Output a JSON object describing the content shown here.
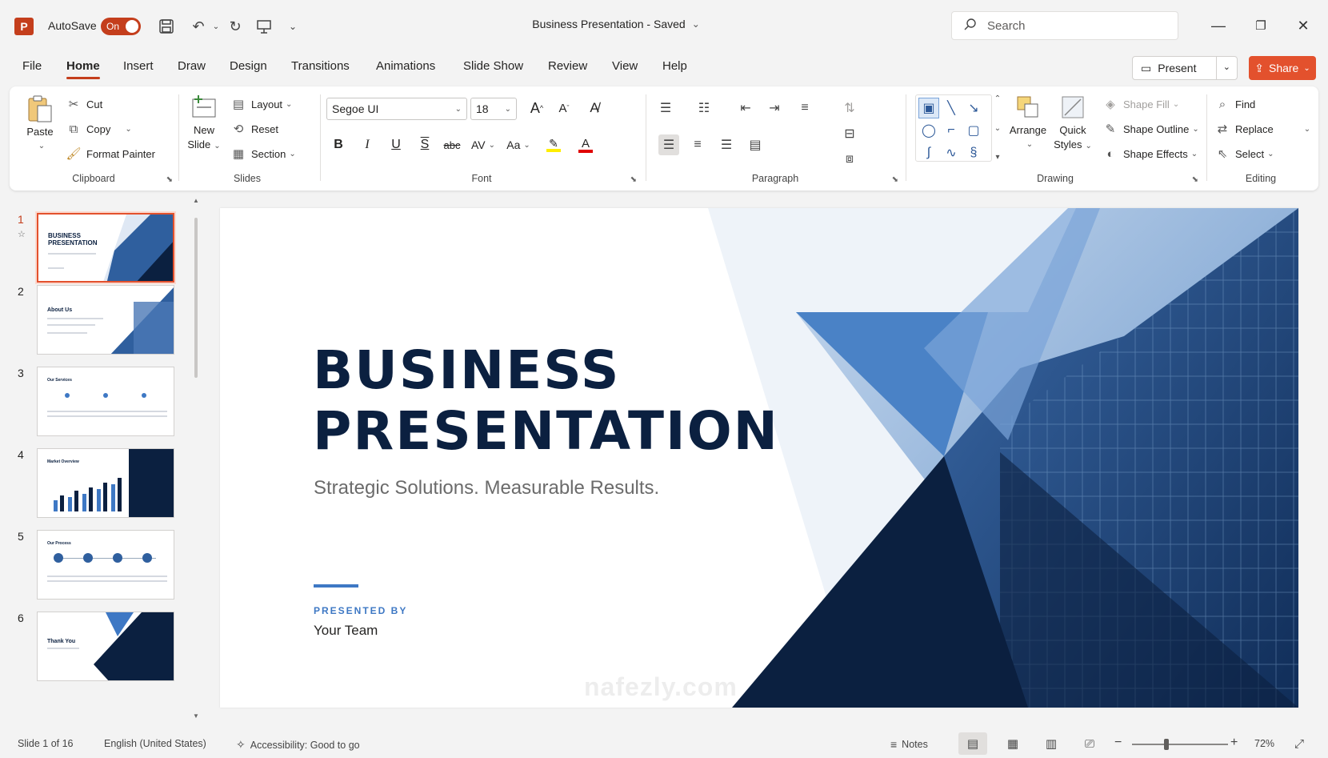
{
  "titlebar": {
    "app_icon": "powerpoint-logo",
    "autosave_label": "AutoSave",
    "autosave_state": "On",
    "doc_title": "Business Presentation  -  Saved",
    "search_placeholder": "Search"
  },
  "tabs": [
    {
      "label": "File"
    },
    {
      "label": "Home"
    },
    {
      "label": "Insert"
    },
    {
      "label": "Draw"
    },
    {
      "label": "Design"
    },
    {
      "label": "Transitions"
    },
    {
      "label": "Animations"
    },
    {
      "label": "Slide Show"
    },
    {
      "label": "Review"
    },
    {
      "label": "View"
    },
    {
      "label": "Help"
    }
  ],
  "active_tab": "Home",
  "present_label": "Present",
  "share_label": "Share",
  "ribbon": {
    "clipboard": {
      "paste": "Paste",
      "cut": "Cut",
      "copy": "Copy",
      "format_painter": "Format Painter",
      "label": "Clipboard"
    },
    "slides": {
      "new_slide_1": "New",
      "new_slide_2": "Slide",
      "layout": "Layout",
      "reset": "Reset",
      "section": "Section",
      "label": "Slides"
    },
    "font": {
      "family": "Segoe UI",
      "size": "18",
      "label": "Font",
      "bold": "B",
      "italic": "I",
      "underline": "U",
      "strike": "S",
      "abc": "abc",
      "spacing": "AV",
      "case": "Aa",
      "highlight": "A",
      "color": "A",
      "grow": "A",
      "shrink": "A"
    },
    "paragraph": {
      "label": "Paragraph"
    },
    "drawing": {
      "arrange": "Arrange",
      "quick_1": "Quick",
      "quick_2": "Styles",
      "shape_fill": "Shape Fill",
      "shape_outline": "Shape Outline",
      "shape_effects": "Shape Effects",
      "label": "Drawing"
    },
    "editing": {
      "find": "Find",
      "replace": "Replace",
      "select": "Select",
      "label": "Editing"
    }
  },
  "thumbnails": [
    {
      "num": "1",
      "title": "BUSINESS\nPRESENTATION"
    },
    {
      "num": "2",
      "title": "About Us"
    },
    {
      "num": "3",
      "title": "Our Services"
    },
    {
      "num": "4",
      "title": "Market Overview"
    },
    {
      "num": "5",
      "title": "Our Process"
    },
    {
      "num": "6",
      "title": "Thank You"
    }
  ],
  "slide": {
    "title_line1": "BUSINESS",
    "title_line2": "PRESENTATION",
    "subtitle": "Strategic Solutions. Measurable Results.",
    "presented_by": "PRESENTED BY",
    "presenter": "Your Team"
  },
  "status": {
    "slide_count": "Slide 1 of 16",
    "language": "English (United States)",
    "accessibility": "Accessibility: Good to go",
    "notes": "Notes",
    "zoom": "72%",
    "zoom_minus": "−",
    "zoom_plus": "+"
  },
  "watermark": "nafezly.com",
  "colors": {
    "accent": "#c43e1c",
    "share": "#e3512d",
    "navy": "#0b2040",
    "blue": "#3e78c4"
  }
}
